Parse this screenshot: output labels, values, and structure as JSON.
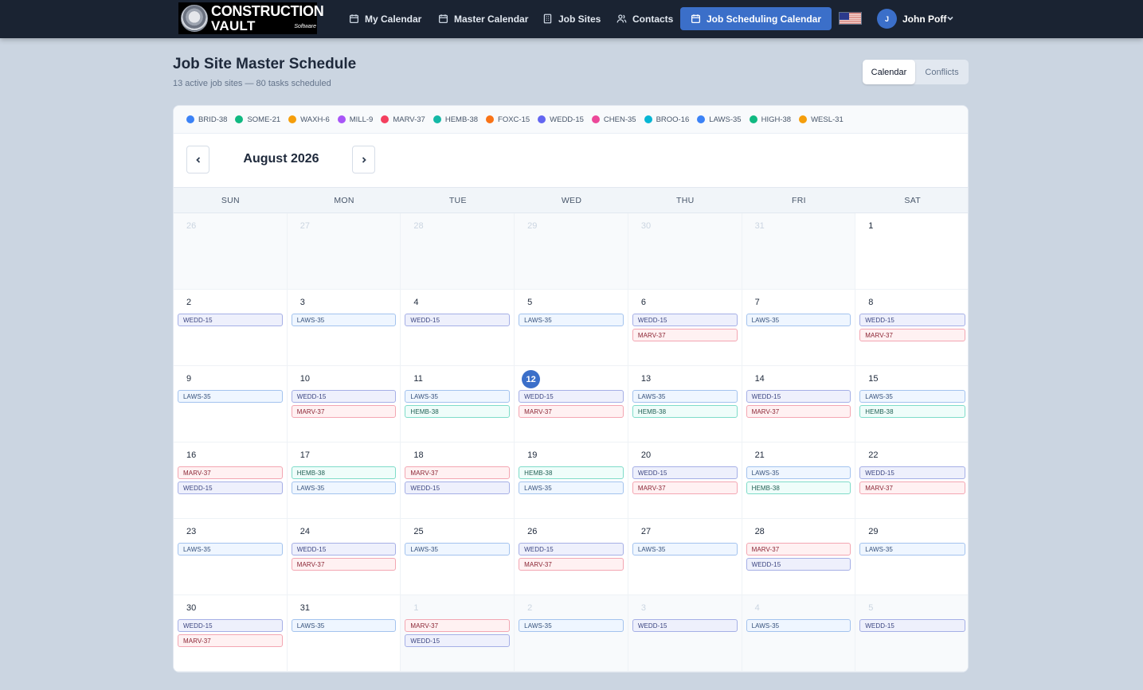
{
  "brand": {
    "line1": "CONSTRUCTION",
    "line2": "VAULT",
    "tag": "Software"
  },
  "nav": [
    {
      "label": "My Calendar",
      "icon": "calendar-icon",
      "active": false
    },
    {
      "label": "Master Calendar",
      "icon": "calendar-icon",
      "active": false
    },
    {
      "label": "Job Sites",
      "icon": "building-icon",
      "active": false
    },
    {
      "label": "Contacts",
      "icon": "users-icon",
      "active": false
    },
    {
      "label": "Job Scheduling Calendar",
      "icon": "calendar-icon",
      "active": true
    }
  ],
  "user": {
    "initial": "J",
    "name": "John Poff",
    "locale_icon": "us-flag-icon"
  },
  "header": {
    "title": "Job Site Master Schedule",
    "subtitle": "13 active job sites — 80 tasks scheduled",
    "views": [
      "Calendar",
      "Conflicts"
    ],
    "active_view": "Calendar"
  },
  "legend": [
    {
      "label": "BRID-38",
      "color": "#3b82f6"
    },
    {
      "label": "SOME-21",
      "color": "#10b981"
    },
    {
      "label": "WAXH-6",
      "color": "#f59e0b"
    },
    {
      "label": "MILL-9",
      "color": "#a855f7"
    },
    {
      "label": "MARV-37",
      "color": "#f43f5e"
    },
    {
      "label": "HEMB-38",
      "color": "#14b8a6"
    },
    {
      "label": "FOXC-15",
      "color": "#f97316"
    },
    {
      "label": "WEDD-15",
      "color": "#6366f1"
    },
    {
      "label": "CHEN-35",
      "color": "#ec4899"
    },
    {
      "label": "BROO-16",
      "color": "#06b6d4"
    },
    {
      "label": "LAWS-35",
      "color": "#3b82f6"
    },
    {
      "label": "HIGH-38",
      "color": "#10b981"
    },
    {
      "label": "WESL-31",
      "color": "#f59e0b"
    }
  ],
  "calendar": {
    "month_label": "August 2026",
    "weekdays": [
      "SUN",
      "MON",
      "TUE",
      "WED",
      "THU",
      "FRI",
      "SAT"
    ],
    "weeks": [
      [
        {
          "day": "26",
          "other": true,
          "tasks": []
        },
        {
          "day": "27",
          "other": true,
          "tasks": []
        },
        {
          "day": "28",
          "other": true,
          "tasks": []
        },
        {
          "day": "29",
          "other": true,
          "tasks": []
        },
        {
          "day": "30",
          "other": true,
          "tasks": []
        },
        {
          "day": "31",
          "other": true,
          "tasks": []
        },
        {
          "day": "1",
          "tasks": []
        }
      ],
      [
        {
          "day": "2",
          "tasks": [
            "WEDD-15"
          ]
        },
        {
          "day": "3",
          "tasks": [
            "LAWS-35"
          ]
        },
        {
          "day": "4",
          "tasks": [
            "WEDD-15"
          ]
        },
        {
          "day": "5",
          "tasks": [
            "LAWS-35"
          ]
        },
        {
          "day": "6",
          "tasks": [
            "WEDD-15",
            "MARV-37"
          ]
        },
        {
          "day": "7",
          "tasks": [
            "LAWS-35"
          ]
        },
        {
          "day": "8",
          "tasks": [
            "WEDD-15",
            "MARV-37"
          ]
        }
      ],
      [
        {
          "day": "9",
          "tasks": [
            "LAWS-35"
          ]
        },
        {
          "day": "10",
          "tasks": [
            "WEDD-15",
            "MARV-37"
          ]
        },
        {
          "day": "11",
          "tasks": [
            "LAWS-35",
            "HEMB-38"
          ]
        },
        {
          "day": "12",
          "today": true,
          "tasks": [
            "WEDD-15",
            "MARV-37"
          ]
        },
        {
          "day": "13",
          "tasks": [
            "LAWS-35",
            "HEMB-38"
          ]
        },
        {
          "day": "14",
          "tasks": [
            "WEDD-15",
            "MARV-37"
          ]
        },
        {
          "day": "15",
          "tasks": [
            "LAWS-35",
            "HEMB-38"
          ]
        }
      ],
      [
        {
          "day": "16",
          "tasks": [
            "MARV-37",
            "WEDD-15"
          ]
        },
        {
          "day": "17",
          "tasks": [
            "HEMB-38",
            "LAWS-35"
          ]
        },
        {
          "day": "18",
          "tasks": [
            "MARV-37",
            "WEDD-15"
          ]
        },
        {
          "day": "19",
          "tasks": [
            "HEMB-38",
            "LAWS-35"
          ]
        },
        {
          "day": "20",
          "tasks": [
            "WEDD-15",
            "MARV-37"
          ]
        },
        {
          "day": "21",
          "tasks": [
            "LAWS-35",
            "HEMB-38"
          ]
        },
        {
          "day": "22",
          "tasks": [
            "WEDD-15",
            "MARV-37"
          ]
        }
      ],
      [
        {
          "day": "23",
          "tasks": [
            "LAWS-35"
          ]
        },
        {
          "day": "24",
          "tasks": [
            "WEDD-15",
            "MARV-37"
          ]
        },
        {
          "day": "25",
          "tasks": [
            "LAWS-35"
          ]
        },
        {
          "day": "26",
          "tasks": [
            "WEDD-15",
            "MARV-37"
          ]
        },
        {
          "day": "27",
          "tasks": [
            "LAWS-35"
          ]
        },
        {
          "day": "28",
          "tasks": [
            "MARV-37",
            "WEDD-15"
          ]
        },
        {
          "day": "29",
          "tasks": [
            "LAWS-35"
          ]
        }
      ],
      [
        {
          "day": "30",
          "tasks": [
            "WEDD-15",
            "MARV-37"
          ]
        },
        {
          "day": "31",
          "tasks": [
            "LAWS-35"
          ]
        },
        {
          "day": "1",
          "other": true,
          "tasks": [
            "MARV-37",
            "WEDD-15"
          ]
        },
        {
          "day": "2",
          "other": true,
          "tasks": [
            "LAWS-35"
          ]
        },
        {
          "day": "3",
          "other": true,
          "tasks": [
            "WEDD-15"
          ]
        },
        {
          "day": "4",
          "other": true,
          "tasks": [
            "LAWS-35"
          ]
        },
        {
          "day": "5",
          "other": true,
          "tasks": [
            "WEDD-15"
          ]
        }
      ]
    ]
  }
}
